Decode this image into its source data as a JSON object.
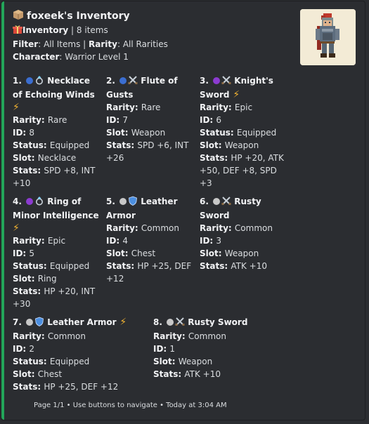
{
  "header": {
    "title": "foxeek's Inventory",
    "inventory_label": "Inventory",
    "inventory_count": "8 items",
    "filter_label": "Filter",
    "filter_value": "All Items",
    "rarity_label": "Rarity",
    "rarity_value": "All Rarities",
    "character_label": "Character",
    "character_value": "Warrior Level 1"
  },
  "colors": {
    "accent": "#23a55a",
    "rare": "#3b6ed1",
    "epic": "#8c3bd1",
    "common": "#c8c8c8",
    "bolt": "#f0b232"
  },
  "items": [
    {
      "num": "1.",
      "rarity_dot": "rare",
      "icon": "ring-icon",
      "name": "Necklace of Echoing Winds",
      "bolt": true,
      "rarity": "Rare",
      "id": "8",
      "status": "Equipped",
      "slot": "Necklace",
      "stats": "SPD +8, INT +10"
    },
    {
      "num": "2.",
      "rarity_dot": "rare",
      "icon": "crossed-swords-icon",
      "name": "Flute of Gusts",
      "bolt": false,
      "rarity": "Rare",
      "id": "7",
      "status": null,
      "slot": "Weapon",
      "stats": "SPD +6, INT +26"
    },
    {
      "num": "3.",
      "rarity_dot": "epic",
      "icon": "crossed-swords-icon",
      "name": "Knight's Sword",
      "bolt": true,
      "rarity": "Epic",
      "id": "6",
      "status": "Equipped",
      "slot": "Weapon",
      "stats": "HP +20, ATK +50, DEF +8, SPD +3"
    },
    {
      "num": "4.",
      "rarity_dot": "epic",
      "icon": "ring-icon",
      "name": "Ring of Minor Intelligence",
      "bolt": true,
      "rarity": "Epic",
      "id": "5",
      "status": "Equipped",
      "slot": "Ring",
      "stats": "HP +20, INT +30"
    },
    {
      "num": "5.",
      "rarity_dot": "common",
      "icon": "shield-icon",
      "name": "Leather Armor",
      "bolt": false,
      "rarity": "Common",
      "id": "4",
      "status": null,
      "slot": "Chest",
      "stats": "HP +25, DEF +12"
    },
    {
      "num": "6.",
      "rarity_dot": "common",
      "icon": "crossed-swords-icon",
      "name": "Rusty Sword",
      "bolt": false,
      "rarity": "Common",
      "id": "3",
      "status": null,
      "slot": "Weapon",
      "stats": "ATK +10"
    },
    {
      "num": "7.",
      "rarity_dot": "common",
      "icon": "shield-icon",
      "name": "Leather Armor",
      "bolt": true,
      "rarity": "Common",
      "id": "2",
      "status": "Equipped",
      "slot": "Chest",
      "stats": "HP +25, DEF +12"
    },
    {
      "num": "8.",
      "rarity_dot": "common",
      "icon": "crossed-swords-icon",
      "name": "Rusty Sword",
      "bolt": false,
      "rarity": "Common",
      "id": "1",
      "status": null,
      "slot": "Weapon",
      "stats": "ATK +10"
    }
  ],
  "field_labels": {
    "rarity": "Rarity:",
    "id": "ID:",
    "status": "Status:",
    "slot": "Slot:",
    "stats": "Stats:"
  },
  "footer": {
    "text": "Page 1/1 • Use buttons to navigate • Today at 3:04 AM"
  }
}
